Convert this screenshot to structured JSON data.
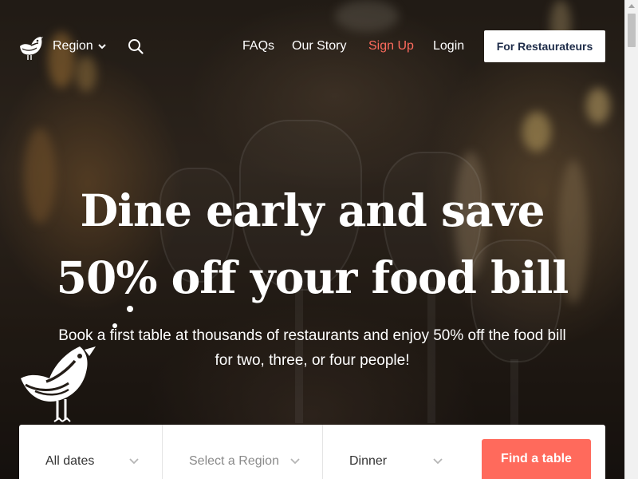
{
  "header": {
    "region_label": "Region",
    "nav": {
      "faqs": "FAQs",
      "our_story": "Our Story",
      "sign_up": "Sign Up",
      "login": "Login"
    },
    "restaurateurs_button": "For Restaurateurs"
  },
  "hero": {
    "headline_line1": "Dine early and save",
    "headline_line2": "50% off your food bill",
    "subtitle_line1": "Book a first table at thousands of restaurants and enjoy 50% off the food bill",
    "subtitle_line2": "for two, three, or four people!"
  },
  "search": {
    "dates_value": "All dates",
    "region_placeholder": "Select a Region",
    "meal_value": "Dinner",
    "find_button": "Find a table"
  },
  "icons": {
    "logo": "bird-logo-icon",
    "region_dropdown": "chevron-down-icon",
    "search": "search-icon",
    "field_dropdown": "chevron-down-icon"
  },
  "colors": {
    "accent": "#ff6a5c",
    "sign_up": "#ff6b5e",
    "button_text": "#1f2d4a"
  }
}
